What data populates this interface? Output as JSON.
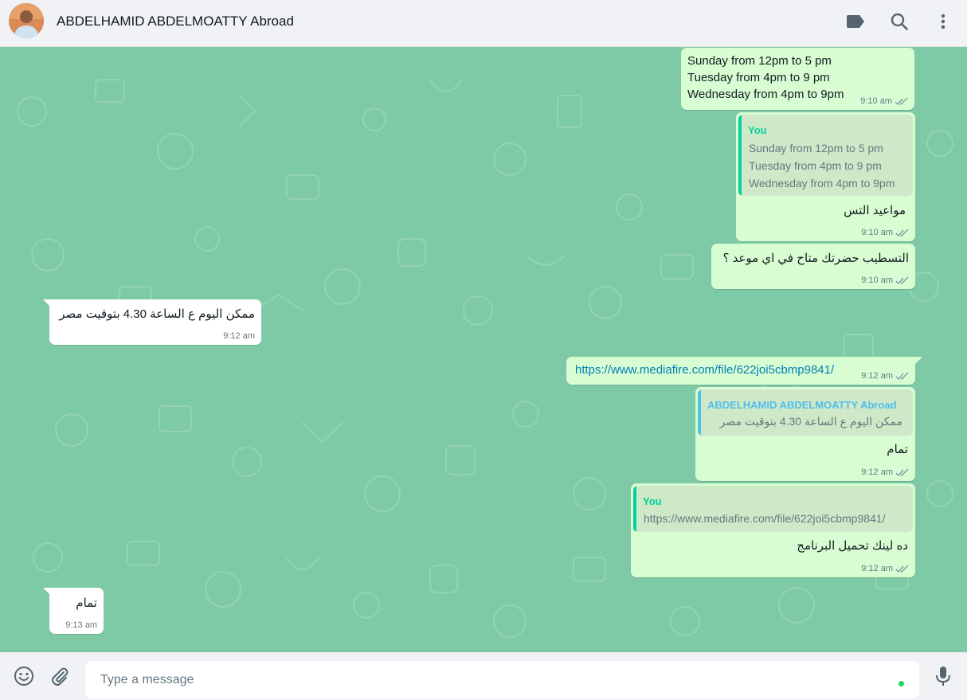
{
  "header": {
    "contact_name": "ABDELHAMID ABDELMOATTY Abroad",
    "icons": [
      "label-icon",
      "search-icon",
      "menu-dots-icon"
    ]
  },
  "messages": [
    {
      "direction": "outgoing",
      "lines": [
        "Sunday from 12pm to 5 pm",
        "Tuesday from 4pm to 9 pm",
        "Wednesday from 4pm to 9pm"
      ],
      "time": "9:10 am",
      "status": "read"
    },
    {
      "direction": "outgoing",
      "quote": {
        "author": "You",
        "lines": [
          "Sunday from 12pm to 5 pm",
          "Tuesday from 4pm to 9 pm",
          "Wednesday from 4pm to 9pm"
        ]
      },
      "text": "مواعيد التس",
      "time": "9:10 am",
      "status": "read"
    },
    {
      "direction": "outgoing",
      "text": "التسطيب حضرتك متاح في اي موعد ؟",
      "time": "9:10 am",
      "status": "read"
    },
    {
      "direction": "incoming",
      "text": "ممكن اليوم ع الساعة 4.30 بتوقيت مصر",
      "time": "9:12 am"
    },
    {
      "direction": "outgoing",
      "text": "https://www.mediafire.com/file/622joi5cbmp9841/",
      "time": "9:12 am",
      "status": "read"
    },
    {
      "direction": "outgoing",
      "quote": {
        "author": "ABDELHAMID ABDELMOATTY Abroad",
        "text": "ممكن اليوم ع الساعة 4.30 بتوقيت مصر"
      },
      "text": "تمام",
      "time": "9:12 am",
      "status": "read"
    },
    {
      "direction": "outgoing",
      "quote": {
        "author": "You",
        "text": "https://www.mediafire.com/file/622joi5cbmp9841/"
      },
      "text": "ده لينك تحميل البرنامج",
      "time": "9:12 am",
      "status": "read"
    },
    {
      "direction": "incoming",
      "text": "تمام",
      "time": "9:13 am"
    }
  ],
  "composer": {
    "placeholder": "Type a message",
    "icons": [
      "emoji-icon",
      "attach-icon",
      "microphone-icon"
    ]
  },
  "colors": {
    "chat_background": "#7fcaa6",
    "outgoing_bubble": "#d9fdd3",
    "incoming_bubble": "#ffffff",
    "read_ticks": "#53bdeb",
    "quote_you": "#06cf9c",
    "quote_other": "#53bdeb",
    "link": "#027eb5"
  }
}
